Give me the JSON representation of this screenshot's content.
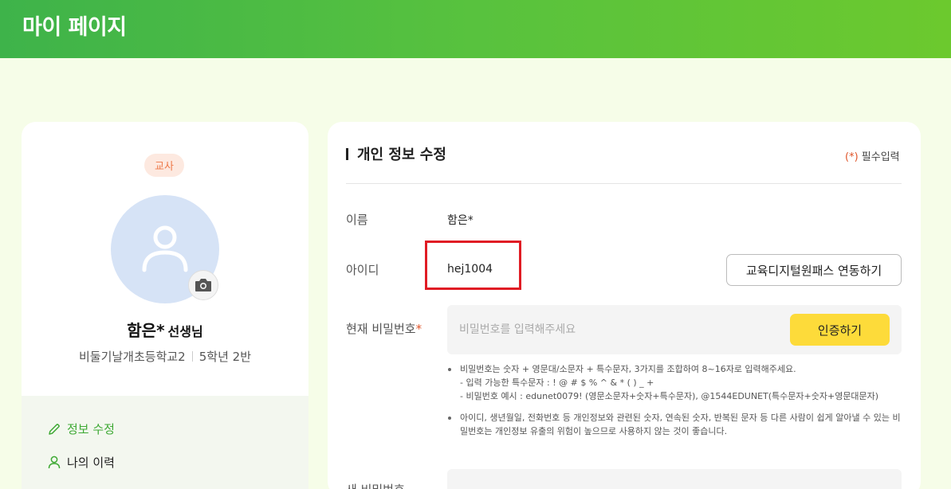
{
  "header": {
    "title": "마이 페이지"
  },
  "profile": {
    "role_badge": "교사",
    "name": "함은*",
    "name_suffix": "선생님",
    "school": "비둘기날개초등학교2",
    "grade_class": "5학년 2반"
  },
  "left_menu": {
    "items": [
      {
        "label": "정보 수정",
        "icon": "pencil-icon",
        "active": true
      },
      {
        "label": "나의 이력",
        "icon": "person-icon",
        "active": false
      }
    ]
  },
  "form": {
    "title": "개인 정보 수정",
    "required_note_star": "(*)",
    "required_note_text": "필수입력",
    "name_label": "이름",
    "name_value": "함은*",
    "id_label": "아이디",
    "id_value": "hej1004",
    "link_button": "교육디지털원패스 연동하기",
    "current_pw_label": "현재 비밀번호",
    "current_pw_required": "*",
    "current_pw_placeholder": "비밀번호를 입력해주세요",
    "verify_button": "인증하기",
    "notes": {
      "note1_line1": "비밀번호는 숫자 + 영문대/소문자 + 특수문자, 3가지를 조합하여 8~16자로 입력해주세요.",
      "note1_line2": "- 입력 가능한 특수문자 : ! @ # $ % ^ & * ( ) _ +",
      "note1_line3": "- 비밀번호 예시 : edunet0079! (영문소문자+숫자+특수문자), @1544EDUNET(특수문자+숫자+영문대문자)",
      "note2": "아이디, 생년월일, 전화번호 등 개인정보와 관련된 숫자, 연속된 숫자, 반복된 문자 등 다른 사람이 쉽게 알아낼 수 있는 비밀번호는 개인정보 유출의 위험이 높으므로 사용하지 않는 것이 좋습니다."
    },
    "new_pw_label": "새 비밀번호"
  },
  "colors": {
    "header_green": "#4cb83e",
    "accent_green": "#3ea934",
    "verify_yellow": "#fddb3a",
    "highlight_red": "#e01c24"
  }
}
